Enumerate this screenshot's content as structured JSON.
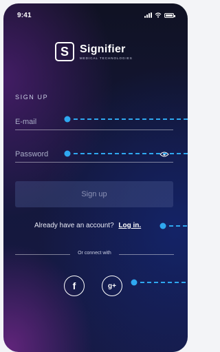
{
  "status_bar": {
    "time": "9:41"
  },
  "brand": {
    "mark": "S",
    "name": "Signifier",
    "tagline": "MEDICAL TECHNOLOGIES"
  },
  "form": {
    "title": "SIGN UP",
    "email_placeholder": "E-mail",
    "password_placeholder": "Password",
    "submit_label": "Sign up"
  },
  "footer": {
    "already_text": "Already have an account?",
    "login_label": "Log in.",
    "connect_text": "Or connect with"
  },
  "social": {
    "facebook_glyph": "f",
    "google_glyph": "g+"
  },
  "colors": {
    "annotation": "#2fa8f0",
    "button_bg": "#3d4a7e"
  }
}
